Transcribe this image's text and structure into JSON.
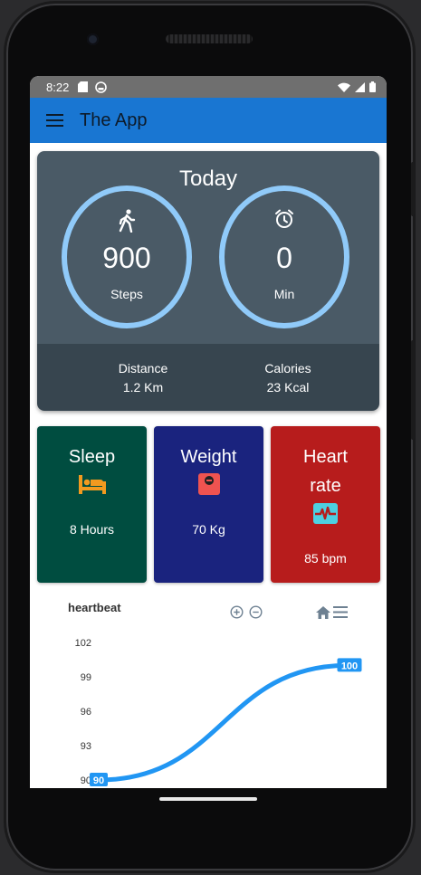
{
  "status_bar": {
    "time": "8:22"
  },
  "app_bar": {
    "title": "The App"
  },
  "today": {
    "title": "Today",
    "steps": {
      "value": "900",
      "unit": "Steps"
    },
    "minutes": {
      "value": "0",
      "unit": "Min"
    },
    "distance": {
      "label": "Distance",
      "value": "1.2 Km"
    },
    "calories": {
      "label": "Calories",
      "value": "23 Kcal"
    }
  },
  "tiles": [
    {
      "title": "Sleep",
      "value": "8 Hours",
      "color": "#004d40"
    },
    {
      "title": "Weight",
      "value": "70 Kg",
      "color": "#1a237e"
    },
    {
      "title_line1": "Heart",
      "title_line2": "rate",
      "value": "85 bpm",
      "color": "#b71c1c"
    }
  ],
  "chart_data": {
    "type": "line",
    "title": "heartbeat",
    "y_ticks": [
      "102",
      "99",
      "96",
      "93",
      "90"
    ],
    "ylim": [
      90,
      102
    ],
    "series": [
      {
        "values": [
          90,
          100
        ],
        "color": "#2196f3"
      }
    ],
    "data_labels": [
      "90",
      "100"
    ]
  }
}
